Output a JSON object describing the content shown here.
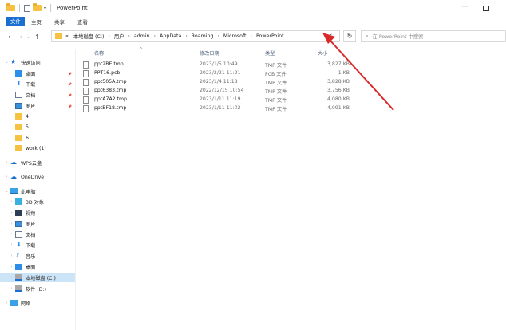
{
  "window": {
    "title": "PowerPoint"
  },
  "ribbon": {
    "tabs": [
      "文件",
      "主页",
      "共享",
      "查看"
    ]
  },
  "nav": {
    "back": "←",
    "forward": "→",
    "up": "↑",
    "history": "⌄"
  },
  "address": {
    "prefix": "«",
    "crumbs": [
      "本地磁盘 (C:)",
      "用户",
      "admin",
      "AppData",
      "Roaming",
      "Microsoft",
      "PowerPoint"
    ],
    "dropdown": "⌄",
    "refresh": "↻"
  },
  "search": {
    "placeholder": "在 PowerPoint 中搜索"
  },
  "sidebar": {
    "items": [
      {
        "label": "快速访问",
        "icon": "star-icon",
        "pinned": false
      },
      {
        "label": "桌面",
        "icon": "desktop-icon",
        "pinned": true
      },
      {
        "label": "下载",
        "icon": "download-icon",
        "pinned": true
      },
      {
        "label": "文档",
        "icon": "document-icon",
        "pinned": true
      },
      {
        "label": "图片",
        "icon": "pictures-icon",
        "pinned": true
      },
      {
        "label": "4",
        "icon": "folder-icon",
        "pinned": false
      },
      {
        "label": "5",
        "icon": "folder-icon",
        "pinned": false
      },
      {
        "label": "6",
        "icon": "folder-icon",
        "pinned": false
      },
      {
        "label": "work (1)",
        "icon": "folder-icon",
        "pinned": false
      },
      {
        "label": "WPS云盘",
        "icon": "cloud-icon",
        "pinned": false
      },
      {
        "label": "OneDrive",
        "icon": "onedrive-icon",
        "pinned": false
      },
      {
        "label": "此电脑",
        "icon": "pc-icon",
        "pinned": false
      },
      {
        "label": "3D 对象",
        "icon": "3d-objects-icon",
        "pinned": false
      },
      {
        "label": "视频",
        "icon": "video-icon",
        "pinned": false
      },
      {
        "label": "图片",
        "icon": "pictures-icon",
        "pinned": false
      },
      {
        "label": "文档",
        "icon": "document-icon",
        "pinned": false
      },
      {
        "label": "下载",
        "icon": "download-icon",
        "pinned": false
      },
      {
        "label": "音乐",
        "icon": "music-icon",
        "pinned": false
      },
      {
        "label": "桌面",
        "icon": "desktop-icon",
        "pinned": false
      },
      {
        "label": "本地磁盘 (C:)",
        "icon": "drive-icon",
        "pinned": false
      },
      {
        "label": "软件 (D:)",
        "icon": "drive-icon",
        "pinned": false
      },
      {
        "label": "网络",
        "icon": "network-icon",
        "pinned": false
      }
    ],
    "selected_item": "本地磁盘 (C:)"
  },
  "file_list": {
    "columns": [
      "名称",
      "修改日期",
      "类型",
      "大小"
    ],
    "rows": [
      {
        "name": "ppt2BE.tmp",
        "modified": "2023/1/5 10:49",
        "type": "TMP 文件",
        "size": "3,827 KB"
      },
      {
        "name": "PPT16.pcb",
        "modified": "2023/2/21 11:21",
        "type": "PCB 文件",
        "size": "1 KB"
      },
      {
        "name": "ppt505A.tmp",
        "modified": "2023/1/4 11:18",
        "type": "TMP 文件",
        "size": "3,828 KB"
      },
      {
        "name": "ppt6383.tmp",
        "modified": "2022/12/15 10:54",
        "type": "TMP 文件",
        "size": "3,756 KB"
      },
      {
        "name": "pptA7A2.tmp",
        "modified": "2023/1/11 11:19",
        "type": "TMP 文件",
        "size": "4,080 KB"
      },
      {
        "name": "pptBF18.tmp",
        "modified": "2023/1/11 11:02",
        "type": "TMP 文件",
        "size": "4,091 KB"
      }
    ]
  },
  "colors": {
    "accent": "#1a6fd1",
    "annotation_arrow": "#d92a2a",
    "selected_bg": "#cce4f7"
  }
}
